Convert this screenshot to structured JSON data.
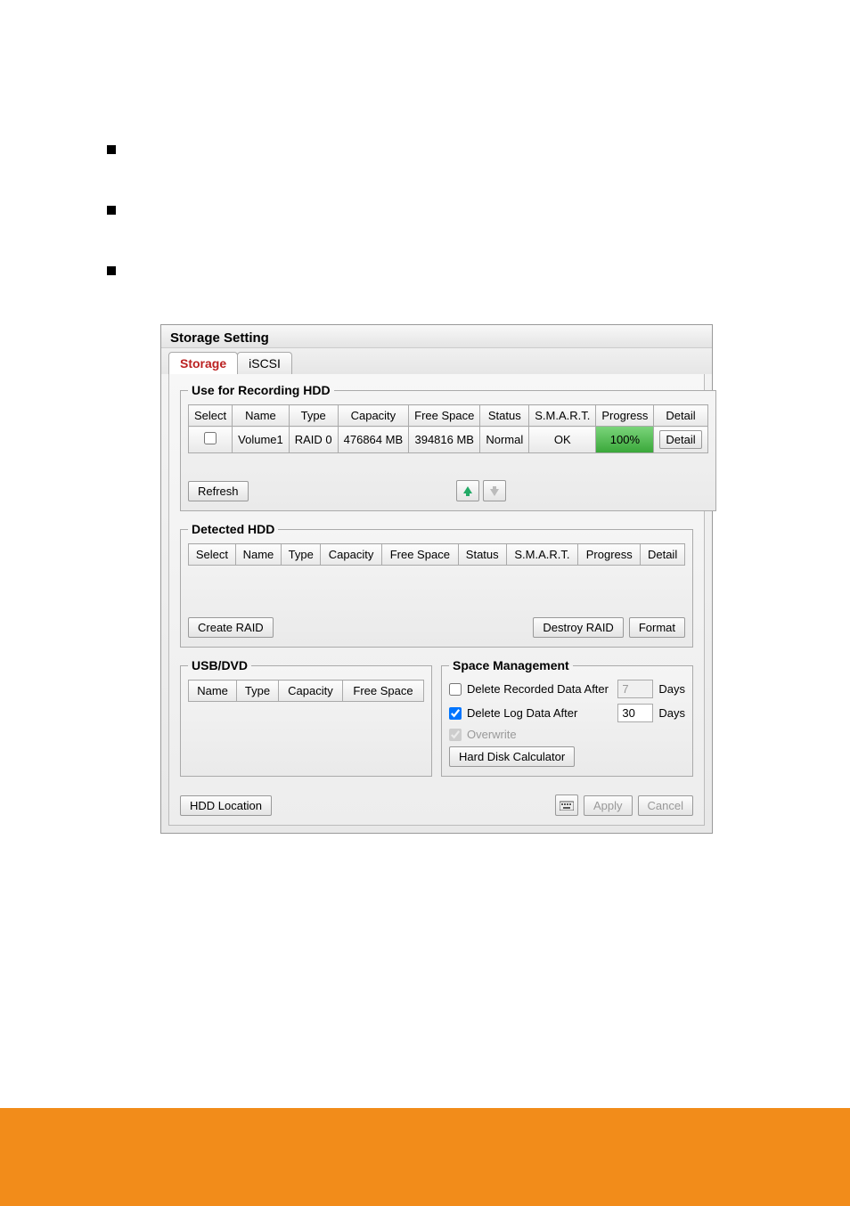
{
  "bullets": {
    "b1": "",
    "b2": "",
    "b3": ""
  },
  "dialog": {
    "title": "Storage Setting",
    "tabs": {
      "storage": "Storage",
      "iscsi": "iSCSI"
    },
    "use_for_recording": {
      "legend": "Use for Recording HDD",
      "headers": {
        "select": "Select",
        "name": "Name",
        "type": "Type",
        "capacity": "Capacity",
        "free_space": "Free Space",
        "status": "Status",
        "smart": "S.M.A.R.T.",
        "progress": "Progress",
        "detail": "Detail"
      },
      "row": {
        "name": "Volume1",
        "type": "RAID 0",
        "capacity": "476864 MB",
        "free_space": "394816 MB",
        "status": "Normal",
        "smart": "OK",
        "progress": "100%",
        "detail": "Detail"
      },
      "refresh": "Refresh"
    },
    "detected_hdd": {
      "legend": "Detected HDD",
      "headers": {
        "select": "Select",
        "name": "Name",
        "type": "Type",
        "capacity": "Capacity",
        "free_space": "Free Space",
        "status": "Status",
        "smart": "S.M.A.R.T.",
        "progress": "Progress",
        "detail": "Detail"
      },
      "create_raid": "Create RAID",
      "destroy_raid": "Destroy RAID",
      "format": "Format"
    },
    "usb_dvd": {
      "legend": "USB/DVD",
      "headers": {
        "name": "Name",
        "type": "Type",
        "capacity": "Capacity",
        "free_space": "Free Space"
      }
    },
    "space_mgmt": {
      "legend": "Space Management",
      "delete_recorded": "Delete Recorded Data After",
      "delete_recorded_value": "7",
      "delete_log": "Delete Log Data After",
      "delete_log_value": "30",
      "days": "Days",
      "overwrite": "Overwrite",
      "hdd_calc": "Hard Disk Calculator"
    },
    "bottom": {
      "hdd_location": "HDD Location",
      "apply": "Apply",
      "cancel": "Cancel"
    }
  }
}
